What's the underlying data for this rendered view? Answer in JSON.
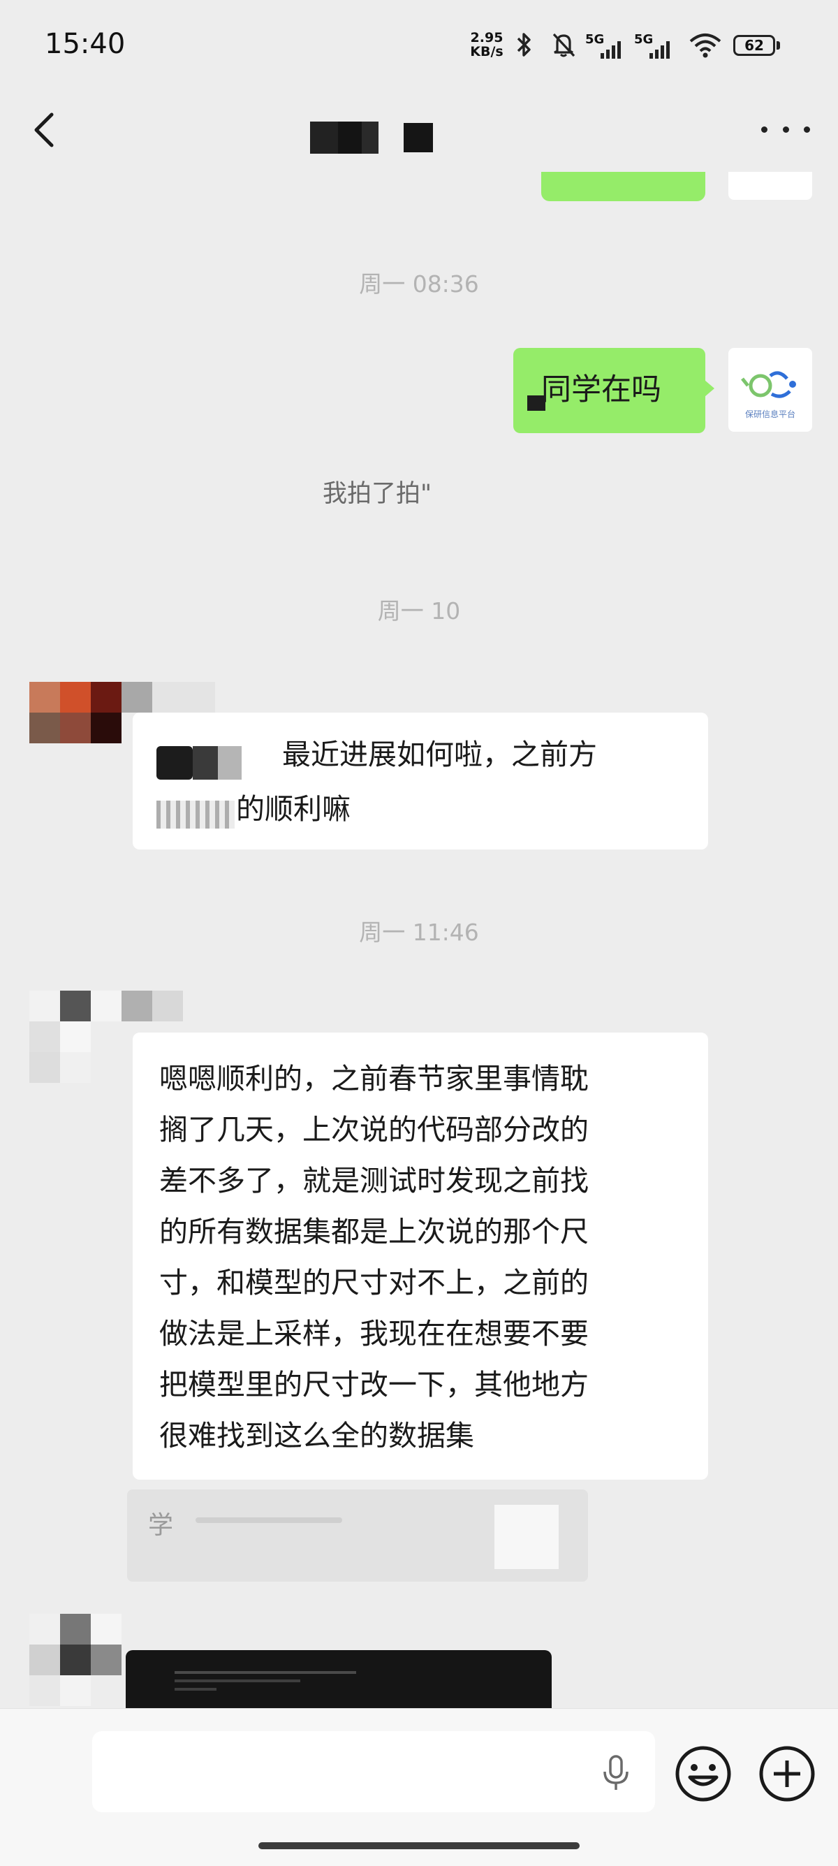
{
  "status_bar": {
    "time": "15:40",
    "net_speed_top": "2.95",
    "net_speed_bottom": "KB/s",
    "sig1_label": "5G",
    "sig2_label": "5G",
    "battery": "62",
    "icons": [
      "bluetooth-icon",
      "mute-bell-icon",
      "signal-icon",
      "signal-icon",
      "wifi-icon",
      "battery-icon"
    ]
  },
  "header": {
    "title_redacted": true,
    "more_label": "more-options"
  },
  "messages": {
    "ts1": "周一 08:36",
    "msg1": "同学在吗",
    "msg1_avatar_caption": "保研信息平台",
    "recall_partial": "我拍了拍\"",
    "ts2": "周一 10",
    "msg2_line1": "最近进展如何啦，之前方",
    "msg2_line2": "的顺利嘛",
    "ts3": "周一 11:46",
    "msg3_lines": [
      "嗯嗯顺利的，之前春节家里事情耽",
      "搁了几天，上次说的代码部分改的",
      "差不多了，就是测试时发现之前找",
      "的所有数据集都是上次说的那个尺",
      "寸，和模型的尺寸对不上，之前的",
      "做法是上采样，我现在在想要不要",
      "把模型里的尺寸改一下，其他地方",
      "很难找到这么全的数据集"
    ],
    "link_partial": "学"
  },
  "colors": {
    "bubble_green": "#95ec69",
    "background": "#ededed",
    "bubble_white": "#ffffff"
  }
}
